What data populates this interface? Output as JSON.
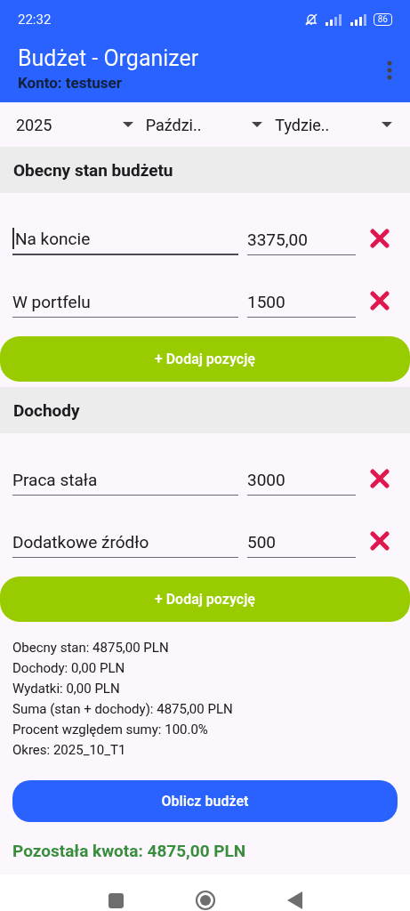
{
  "status_bar": {
    "time": "22:32",
    "battery": "86"
  },
  "app_bar": {
    "title": "Budżet - Organizer",
    "subtitle": "Konto: testuser"
  },
  "selectors": [
    {
      "value": "2025"
    },
    {
      "value": "Paździ.."
    },
    {
      "value": "Tydzie.."
    }
  ],
  "sections": [
    {
      "title": "Obecny stan budżetu",
      "items": [
        {
          "name": "Na koncie",
          "amount": "3375,00",
          "focused": true
        },
        {
          "name": "W portfelu",
          "amount": "1500",
          "focused": false
        }
      ],
      "add_button": "+ Dodaj pozycję"
    },
    {
      "title": "Dochody",
      "items": [
        {
          "name": "Praca stała",
          "amount": "3000",
          "focused": false
        },
        {
          "name": "Dodatkowe źródło",
          "amount": "500",
          "focused": false
        }
      ],
      "add_button": "+ Dodaj pozycję"
    }
  ],
  "summary": [
    "Obecny stan: 4875,00 PLN",
    "Dochody: 0,00 PLN",
    "Wydatki: 0,00 PLN",
    "Suma (stan + dochody): 4875,00 PLN",
    "Procent względem sumy: 100.0%",
    "Okres: 2025_10_T1"
  ],
  "calculate_button": "Oblicz budżet",
  "result": "Pozostała kwota: 4875,00 PLN"
}
